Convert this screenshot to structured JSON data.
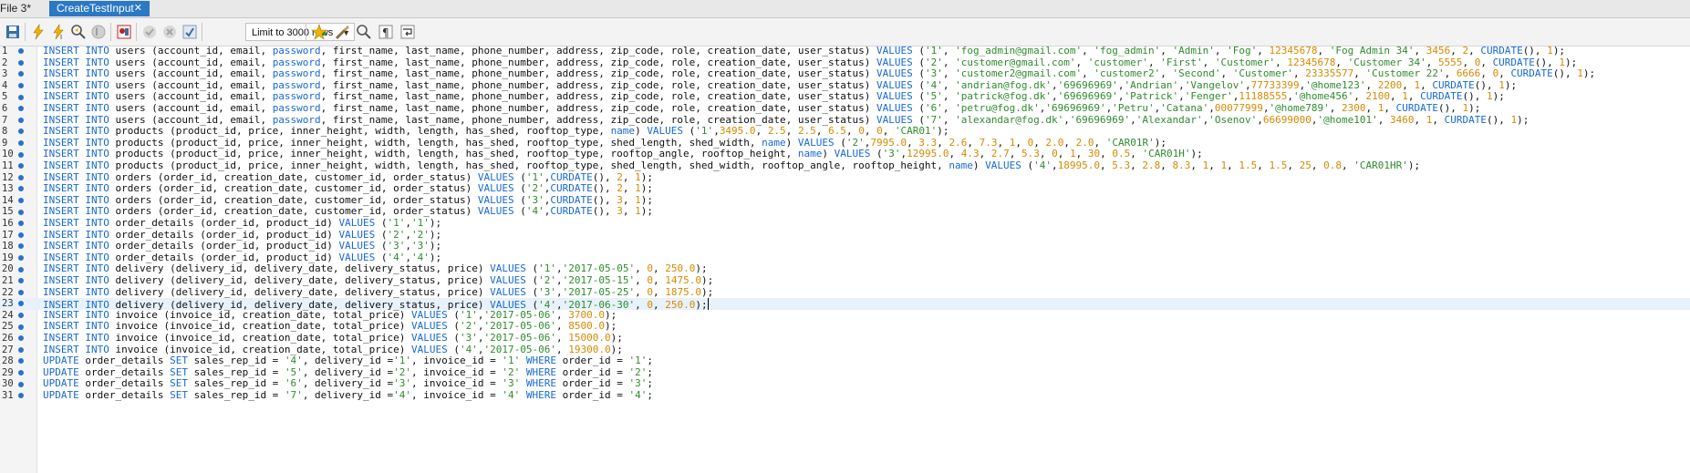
{
  "tabs": [
    {
      "label": "File 3*",
      "active": false
    },
    {
      "label": "CreateTestInput",
      "active": true,
      "close": "✕"
    }
  ],
  "toolbar": {
    "limit_label": "Limit to 3000 rows",
    "icons": [
      "save-icon",
      "execute-icon",
      "execute-current-icon",
      "explain-icon",
      "stop-icon",
      "toggle-continue-icon",
      "commit-icon",
      "rollback-icon",
      "autocommit-icon",
      "bookmark-icon",
      "beautify-icon",
      "find-icon",
      "invisible-chars-icon",
      "wrap-icon"
    ]
  },
  "colors": {
    "keyword": "#1769d5",
    "string": "#2f8b2f",
    "number": "#d58a00",
    "tab_active": "#2b78c5",
    "marker": "#2a72c9"
  },
  "lines": [
    "INSERT INTO users (account_id, email, password, first_name, last_name, phone_number, address, zip_code, role, creation_date, user_status) VALUES ('1', 'fog_admin@gmail.com', 'fog_admin', 'Admin', 'Fog', 12345678, 'Fog Admin 34', 3456, 2, CURDATE(), 1);",
    "INSERT INTO users (account_id, email, password, first_name, last_name, phone_number, address, zip_code, role, creation_date, user_status) VALUES ('2', 'customer@gmail.com', 'customer', 'First', 'Customer', 12345678, 'Customer 34', 5555, 0, CURDATE(), 1);",
    "INSERT INTO users (account_id, email, password, first_name, last_name, phone_number, address, zip_code, role, creation_date, user_status) VALUES ('3', 'customer2@gmail.com', 'customer2', 'Second', 'Customer', 23335577, 'Customer 22', 6666, 0, CURDATE(), 1);",
    "INSERT INTO users (account_id, email, password, first_name, last_name, phone_number, address, zip_code, role, creation_date, user_status) VALUES ('4', 'andrian@fog.dk','69696969','Andrian','Vangelov',77733399,'@home123', 2200, 1, CURDATE(), 1);",
    "INSERT INTO users (account_id, email, password, first_name, last_name, phone_number, address, zip_code, role, creation_date, user_status) VALUES ('5', 'patrick@fog.dk','69696969','Patrick','Fenger',11188555,'@home456', 2100, 1, CURDATE(), 1);",
    "INSERT INTO users (account_id, email, password, first_name, last_name, phone_number, address, zip_code, role, creation_date, user_status) VALUES ('6', 'petru@fog.dk','69696969','Petru','Catana',00077999,'@home789', 2300, 1, CURDATE(), 1);",
    "INSERT INTO users (account_id, email, password, first_name, last_name, phone_number, address, zip_code, role, creation_date, user_status) VALUES ('7', 'alexandar@fog.dk','69696969','Alexandar','Osenov',66699000,'@home101', 3460, 1, CURDATE(), 1);",
    "INSERT INTO products (product_id, price, inner_height, width, length, has_shed, rooftop_type, name) VALUES ('1',3495.0, 2.5, 2.5, 6.5, 0, 0, 'CAR01');",
    "INSERT INTO products (product_id, price, inner_height, width, length, has_shed, rooftop_type, shed_length, shed_width, name) VALUES ('2',7995.0, 3.3, 2.6, 7.3, 1, 0, 2.0, 2.0, 'CAR01R');",
    "INSERT INTO products (product_id, price, inner_height, width, length, has_shed, rooftop_type, rooftop_angle, rooftop_height, name) VALUES ('3',12995.0, 4.3, 2.7, 5.3, 0, 1, 30, 0.5, 'CAR01H');",
    "INSERT INTO products (product_id, price, inner_height, width, length, has_shed, rooftop_type, shed_length, shed_width, rooftop_angle, rooftop_height, name) VALUES ('4',18995.0, 5.3, 2.8, 8.3, 1, 1, 1.5, 1.5, 25, 0.8, 'CAR01HR');",
    "INSERT INTO orders (order_id, creation_date, customer_id, order_status) VALUES ('1',CURDATE(), 2, 1);",
    "INSERT INTO orders (order_id, creation_date, customer_id, order_status) VALUES ('2',CURDATE(), 2, 1);",
    "INSERT INTO orders (order_id, creation_date, customer_id, order_status) VALUES ('3',CURDATE(), 3, 1);",
    "INSERT INTO orders (order_id, creation_date, customer_id, order_status) VALUES ('4',CURDATE(), 3, 1);",
    "INSERT INTO order_details (order_id, product_id) VALUES ('1','1');",
    "INSERT INTO order_details (order_id, product_id) VALUES ('2','2');",
    "INSERT INTO order_details (order_id, product_id) VALUES ('3','3');",
    "INSERT INTO order_details (order_id, product_id) VALUES ('4','4');",
    "INSERT INTO delivery (delivery_id, delivery_date, delivery_status, price) VALUES ('1','2017-05-05', 0, 250.0);",
    "INSERT INTO delivery (delivery_id, delivery_date, delivery_status, price) VALUES ('2','2017-05-15', 0, 1475.0);",
    "INSERT INTO delivery (delivery_id, delivery_date, delivery_status, price) VALUES ('3','2017-05-25', 0, 1875.0);",
    "INSERT INTO delivery (delivery_id, delivery_date, delivery_status, price) VALUES ('4','2017-06-30', 0, 250.0);",
    "INSERT INTO invoice (invoice_id, creation_date, total_price) VALUES ('1','2017-05-06', 3700.0);",
    "INSERT INTO invoice (invoice_id, creation_date, total_price) VALUES ('2','2017-05-06', 8500.0);",
    "INSERT INTO invoice (invoice_id, creation_date, total_price) VALUES ('3','2017-05-06', 15000.0);",
    "INSERT INTO invoice (invoice_id, creation_date, total_price) VALUES ('4','2017-05-06', 19300.0);",
    "UPDATE order_details SET sales_rep_id = '4', delivery_id ='1', invoice_id = '1' WHERE order_id = '1';",
    "UPDATE order_details SET sales_rep_id = '5', delivery_id ='2', invoice_id = '2' WHERE order_id = '2';",
    "UPDATE order_details SET sales_rep_id = '6', delivery_id ='3', invoice_id = '3' WHERE order_id = '3';",
    "UPDATE order_details SET sales_rep_id = '7', delivery_id ='4', invoice_id = '4' WHERE order_id = '4';"
  ],
  "cursor_line": 23
}
